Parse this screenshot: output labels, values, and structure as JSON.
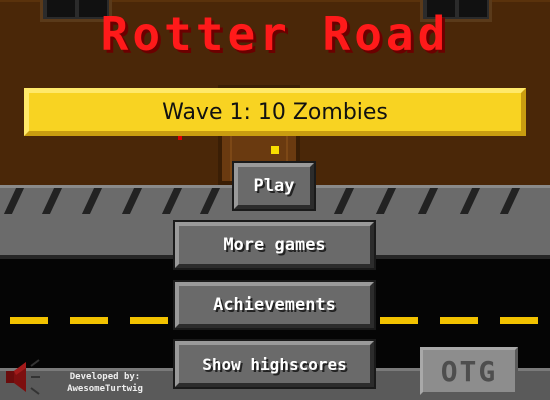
{
  "game": {
    "title": "Rotter Road",
    "wave_banner": "Wave 1: 10 Zombies"
  },
  "menu": {
    "play": "Play",
    "more_games": "More games",
    "achievements": "Achievements",
    "show_highscores": "Show highscores"
  },
  "footer": {
    "developed_by_label": "Developed by:",
    "developer_name": "AwesomeTurtwig",
    "sponsor_logo": "OTG",
    "sound_icon": "speaker-muted-icon"
  },
  "colors": {
    "title_red": "#ff1a1a",
    "banner_yellow": "#f8d322",
    "building_brown": "#4a2708",
    "sidewalk_gray": "#6b6b6b",
    "road_black": "#050505",
    "lane_yellow": "#f2c200"
  }
}
